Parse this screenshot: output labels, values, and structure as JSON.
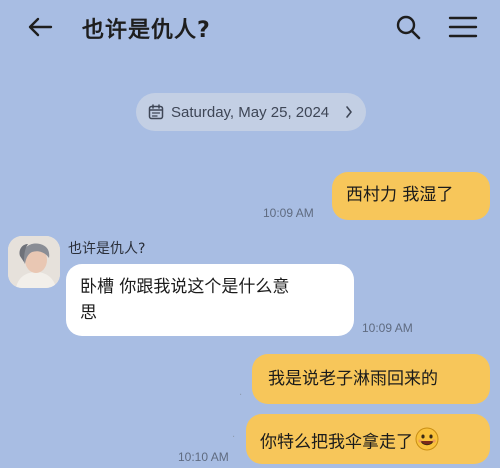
{
  "header": {
    "title": "也许是仇人?"
  },
  "date_separator": {
    "label": "Saturday, May 25, 2024"
  },
  "messages": [
    {
      "direction": "outgoing",
      "text": "西村力 我湿了",
      "time": "10:09 AM"
    },
    {
      "direction": "incoming",
      "sender": "也许是仇人?",
      "line1": "卧槽 你跟我说这个是什么意",
      "line2": "思",
      "time": "10:09 AM"
    },
    {
      "direction": "outgoing",
      "text": "我是说老子淋雨回来的",
      "time": ""
    },
    {
      "direction": "outgoing",
      "text": "你特么把我伞拿走了",
      "time": "10:10 AM",
      "emoji": "smiling-face-icon"
    }
  ],
  "colors": {
    "background": "#a8bde3",
    "outgoing_bubble": "#f7c65a",
    "incoming_bubble": "#ffffff"
  }
}
